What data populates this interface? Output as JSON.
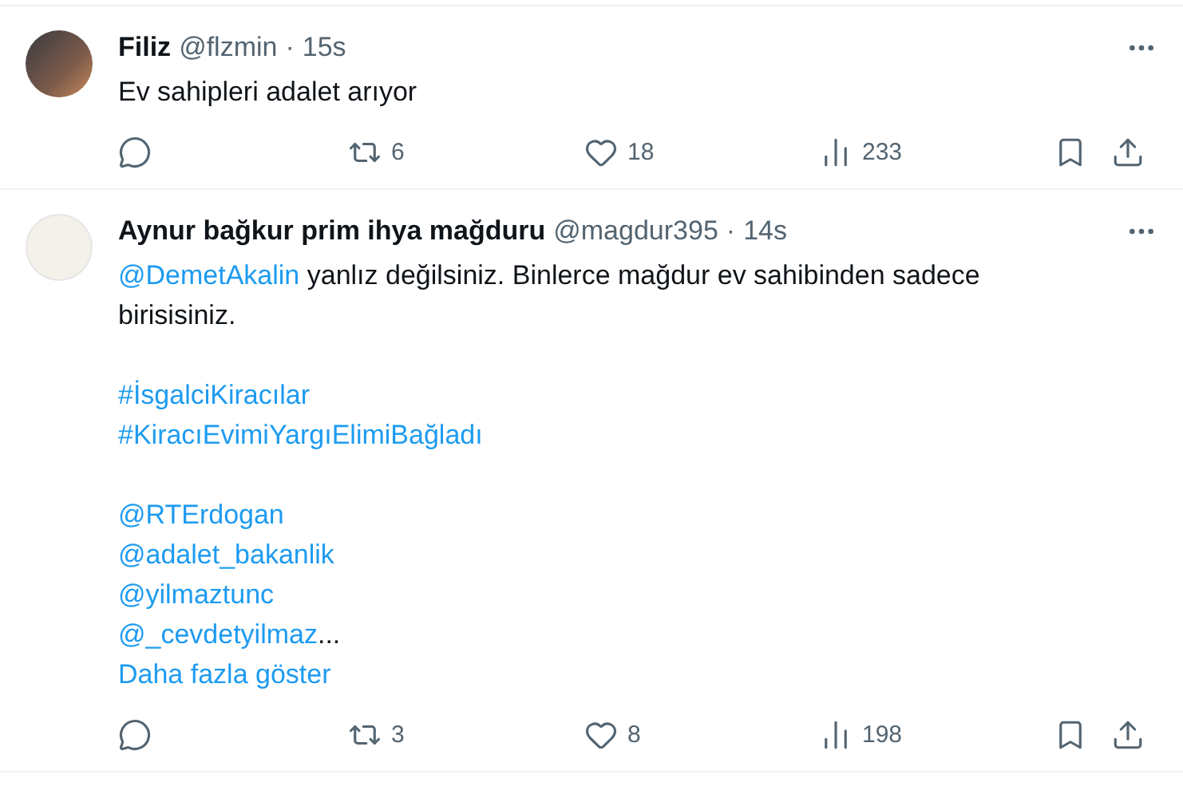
{
  "tweets": [
    {
      "name": "Filiz",
      "handle": "@flzmin",
      "separator": "·",
      "time": "15s",
      "avatar": {
        "kind": "photo"
      },
      "paragraphs": [
        {
          "lines": [
            [
              {
                "kind": "text",
                "text": "Ev sahipleri adalet arıyor"
              }
            ]
          ]
        }
      ],
      "actions": [
        {
          "kind": "reply"
        },
        {
          "kind": "retweet",
          "count": "6"
        },
        {
          "kind": "like",
          "count": "18"
        },
        {
          "kind": "views",
          "count": "233"
        },
        {
          "kind": "bookmark"
        },
        {
          "kind": "share"
        }
      ]
    },
    {
      "name": "Aynur bağkur prim ihya mağduru",
      "handle": "@magdur395",
      "separator": "·",
      "time": "14s",
      "avatar": {
        "kind": "poster"
      },
      "paragraphs": [
        {
          "lines": [
            [
              {
                "kind": "mention",
                "text": "@DemetAkalin"
              },
              {
                "kind": "text",
                "text": " yanlız değilsiniz. Binlerce mağdur ev sahibinden sadece birisisiniz."
              }
            ]
          ]
        },
        {
          "lines": [
            [
              {
                "kind": "hashtag",
                "text": "#İsgalciKiracılar"
              }
            ],
            [
              {
                "kind": "hashtag",
                "text": "#KiracıEvimiYargıElimiBağladı"
              }
            ]
          ]
        },
        {
          "lines": [
            [
              {
                "kind": "mention",
                "text": "@RTErdogan"
              }
            ],
            [
              {
                "kind": "mention",
                "text": "@adalet_bakanlik"
              }
            ],
            [
              {
                "kind": "mention",
                "text": "@yilmaztunc"
              }
            ],
            [
              {
                "kind": "mention",
                "text": "@_cevdetyilmaz"
              },
              {
                "kind": "text",
                "text": "..."
              }
            ]
          ]
        }
      ],
      "show_more": "Daha fazla göster",
      "actions": [
        {
          "kind": "reply"
        },
        {
          "kind": "retweet",
          "count": "3"
        },
        {
          "kind": "like",
          "count": "8"
        },
        {
          "kind": "views",
          "count": "198"
        },
        {
          "kind": "bookmark"
        },
        {
          "kind": "share"
        }
      ]
    }
  ]
}
